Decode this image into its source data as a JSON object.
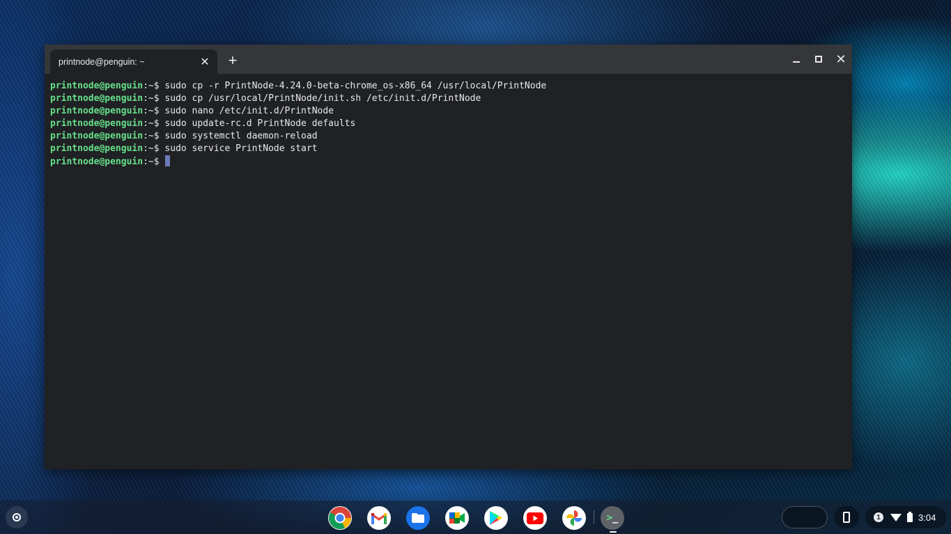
{
  "window": {
    "tab_title": "printnode@penguin: ~",
    "tab_close_glyph": "✕",
    "new_tab_glyph": "+"
  },
  "terminal": {
    "lines": [
      {
        "user": "printnode@penguin",
        "path": ":~$ ",
        "command": "sudo cp -r PrintNode-4.24.0-beta-chrome_os-x86_64 /usr/local/PrintNode"
      },
      {
        "user": "printnode@penguin",
        "path": ":~$ ",
        "command": "sudo cp /usr/local/PrintNode/init.sh /etc/init.d/PrintNode"
      },
      {
        "user": "printnode@penguin",
        "path": ":~$ ",
        "command": "sudo nano /etc/init.d/PrintNode"
      },
      {
        "user": "printnode@penguin",
        "path": ":~$ ",
        "command": "sudo update-rc.d PrintNode defaults"
      },
      {
        "user": "printnode@penguin",
        "path": ":~$ ",
        "command": "sudo systemctl daemon-reload"
      },
      {
        "user": "printnode@penguin",
        "path": ":~$ ",
        "command": "sudo service PrintNode start"
      },
      {
        "user": "printnode@penguin",
        "path": ":~$",
        "command": ""
      }
    ],
    "colors": {
      "background": "#202124",
      "prompt_user": "#66e08b",
      "text": "#e8eaed",
      "cursor": "#6c7ab8"
    }
  },
  "shelf": {
    "apps": [
      "chrome-icon",
      "gmail-icon",
      "files-icon",
      "meet-icon",
      "play-store-icon",
      "youtube-icon",
      "photos-icon"
    ],
    "terminal_glyph_gt": ">",
    "terminal_glyph_underscore": "_",
    "notification_count": "1",
    "clock": "3:04"
  }
}
